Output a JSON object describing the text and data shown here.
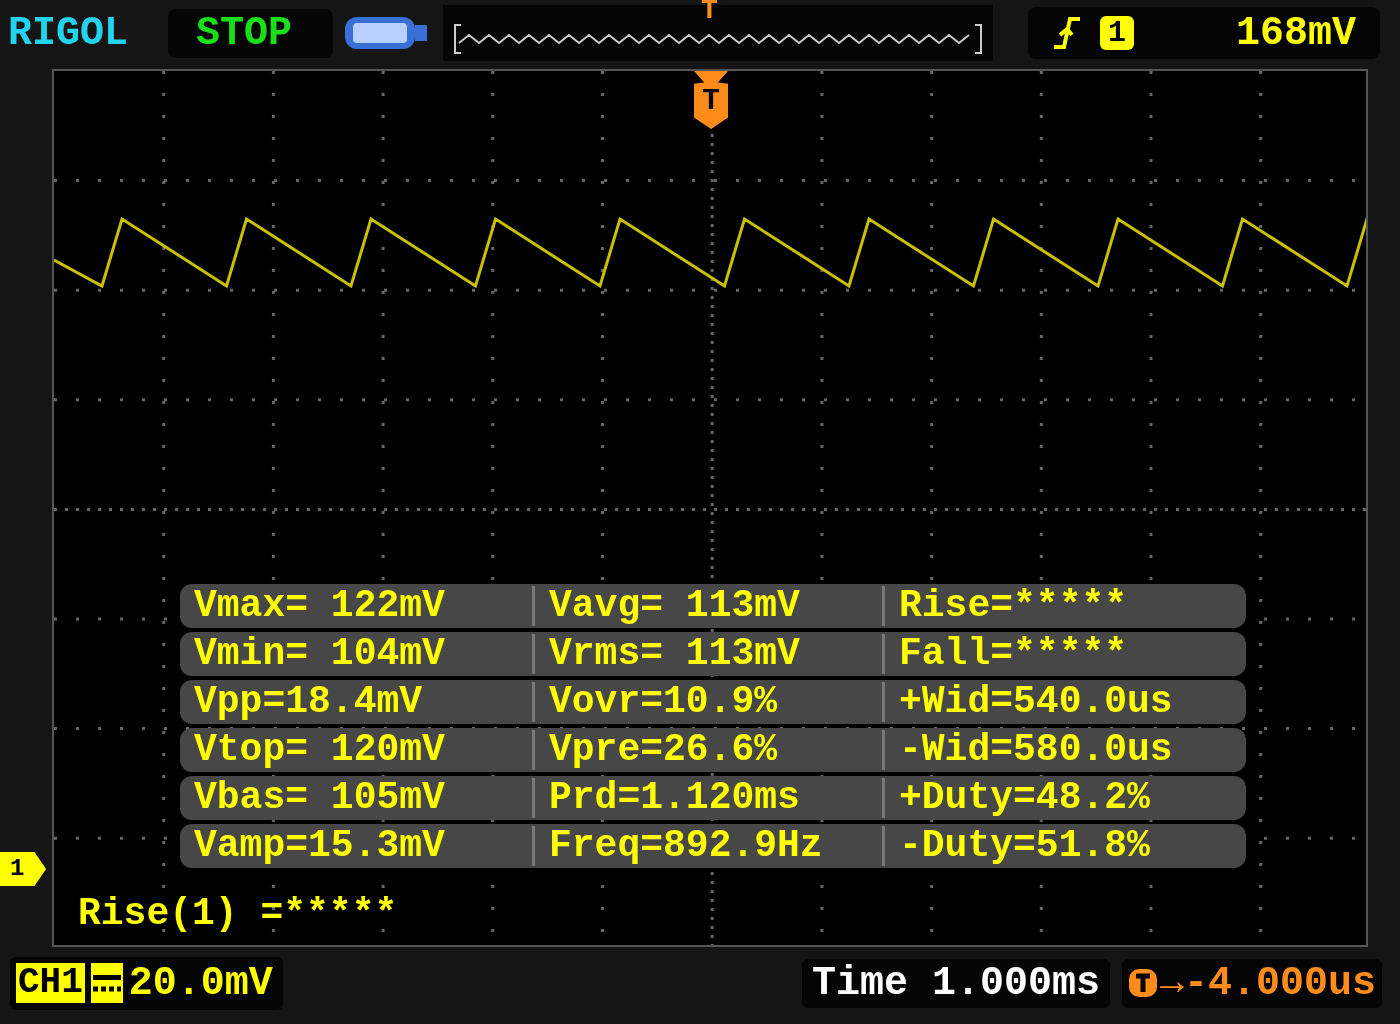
{
  "header": {
    "brand": "RIGOL",
    "run_state": "STOP",
    "position_marker": "T",
    "trigger_source": "1",
    "trigger_level": "168mV"
  },
  "screen": {
    "trigger_marker": "T",
    "channel_marker": "1",
    "cursor_readout": "Rise(1) =*****"
  },
  "measurements": [
    [
      "Vmax= 122mV",
      "Vavg= 113mV",
      "Rise=*****"
    ],
    [
      "Vmin= 104mV",
      "Vrms= 113mV",
      "Fall=*****"
    ],
    [
      "Vpp=18.4mV",
      "Vovr=10.9%",
      "+Wid=540.0us"
    ],
    [
      "Vtop= 120mV",
      "Vpre=26.6%",
      "-Wid=580.0us"
    ],
    [
      "Vbas= 105mV",
      "Prd=1.120ms",
      "+Duty=48.2%"
    ],
    [
      "Vamp=15.3mV",
      "Freq=892.9Hz",
      "-Duty=51.8%"
    ]
  ],
  "footer": {
    "channel": "CH1",
    "scale": "20.0mV",
    "timebase": "Time 1.000ms",
    "trigger_offset": "→-4.000us"
  }
}
